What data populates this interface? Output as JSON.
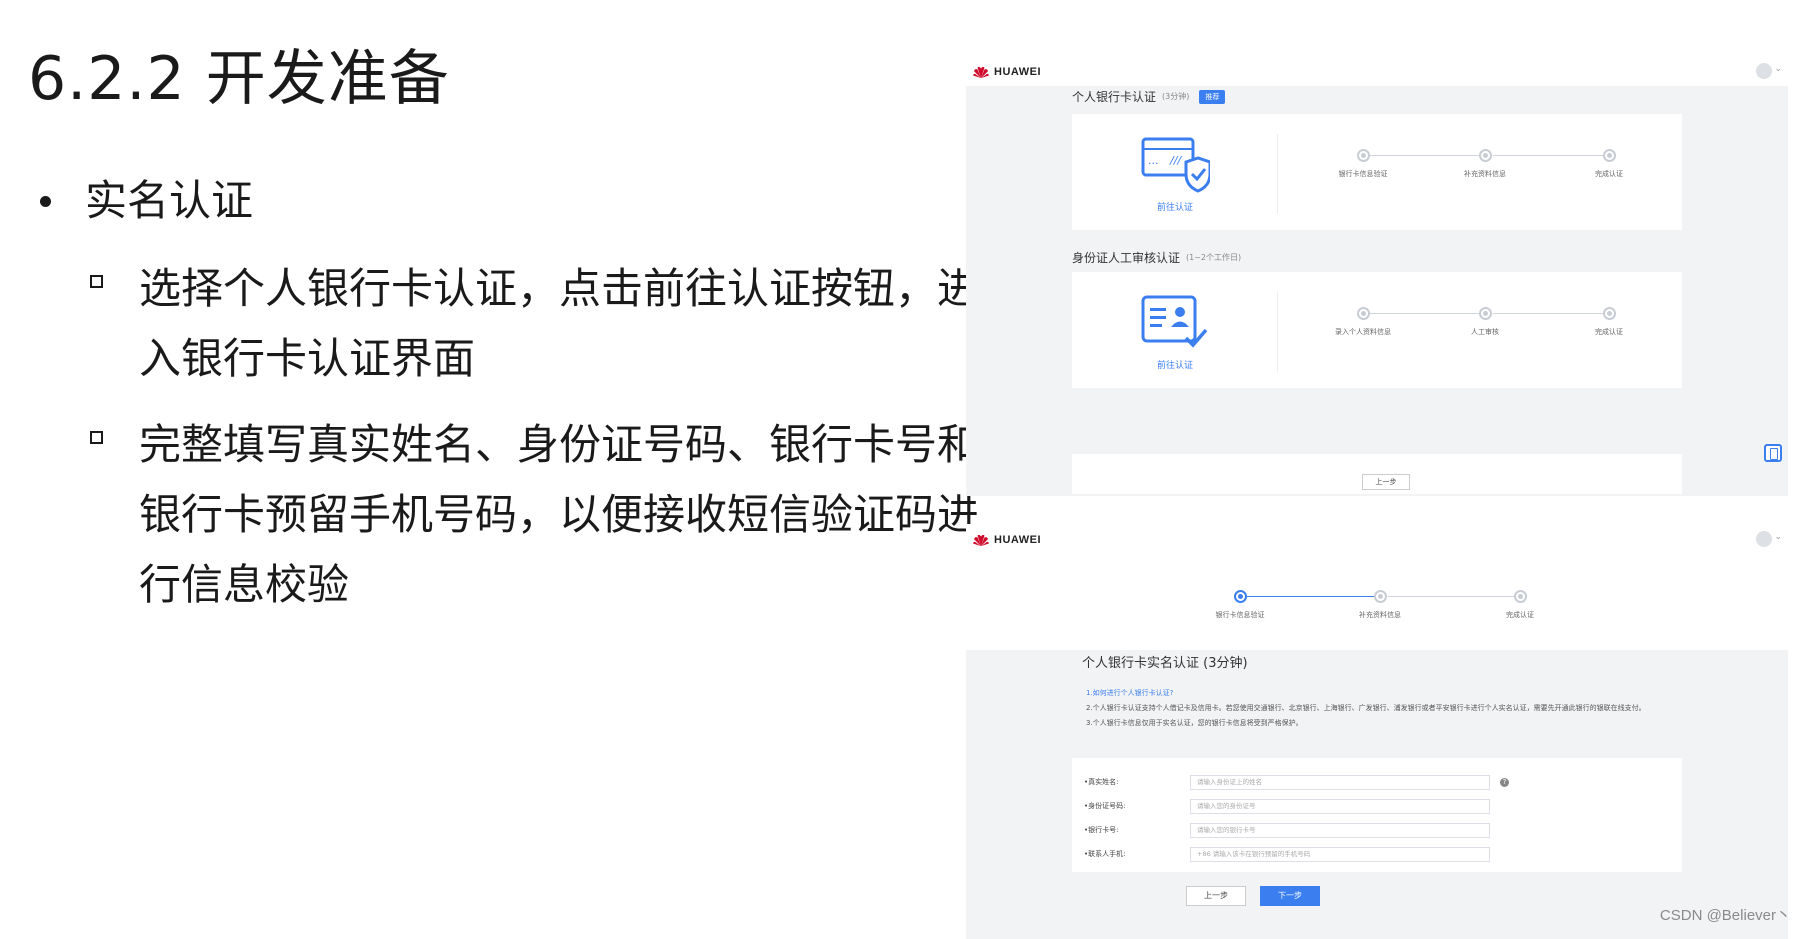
{
  "slide": {
    "title": "6.2.2 开发准备",
    "main_bullet": "实名认证",
    "sub_bullets": [
      "选择个人银行卡认证，点击前往认证按钮，进入银行卡认证界面",
      "完整填写真实姓名、身份证号码、银行卡号和银行卡预留手机号码，以便接收短信验证码进行信息校验"
    ]
  },
  "screenshot1": {
    "brand": "HUAWEI",
    "bank_section": {
      "title": "个人银行卡认证",
      "note": "(3分钟)",
      "tag": "推荐",
      "link": "前往认证",
      "steps": [
        "银行卡信息验证",
        "补充资料信息",
        "完成认证"
      ]
    },
    "id_section": {
      "title": "身份证人工审核认证",
      "note": "(1~2个工作日)",
      "link": "前往认证",
      "steps": [
        "录入个人资料信息",
        "人工审核",
        "完成认证"
      ]
    },
    "prev_button": "上一步"
  },
  "screenshot2": {
    "brand": "HUAWEI",
    "steps": [
      "银行卡信息验证",
      "补充资料信息",
      "完成认证"
    ],
    "form_title": "个人银行卡实名认证 (3分钟)",
    "info": [
      "1.如何进行个人银行卡认证?",
      "2.个人银行卡认证支持个人借记卡及信用卡。若您使用交通银行、北京银行、上海银行、广发银行、浦发银行或者平安银行卡进行个人实名认证，需要先开通此银行的银联在线支付。",
      "3.个人银行卡信息仅用于实名认证，您的银行卡信息将受到严格保护。"
    ],
    "fields": [
      {
        "label": "•真实姓名:",
        "placeholder": "请输入身份证上的姓名"
      },
      {
        "label": "•身份证号码:",
        "placeholder": "请输入您的身份证号"
      },
      {
        "label": "•银行卡号:",
        "placeholder": "请输入您的银行卡号"
      },
      {
        "label": "•联系人手机:",
        "placeholder": "+86    请输入该卡在银行预留的手机号码"
      }
    ],
    "help_icon": "?",
    "prev_button": "上一步",
    "next_button": "下一步"
  },
  "watermark": "CSDN @Believer丶",
  "colors": {
    "accent": "#3b7ef0",
    "huawei_red": "#cf0a2c"
  }
}
